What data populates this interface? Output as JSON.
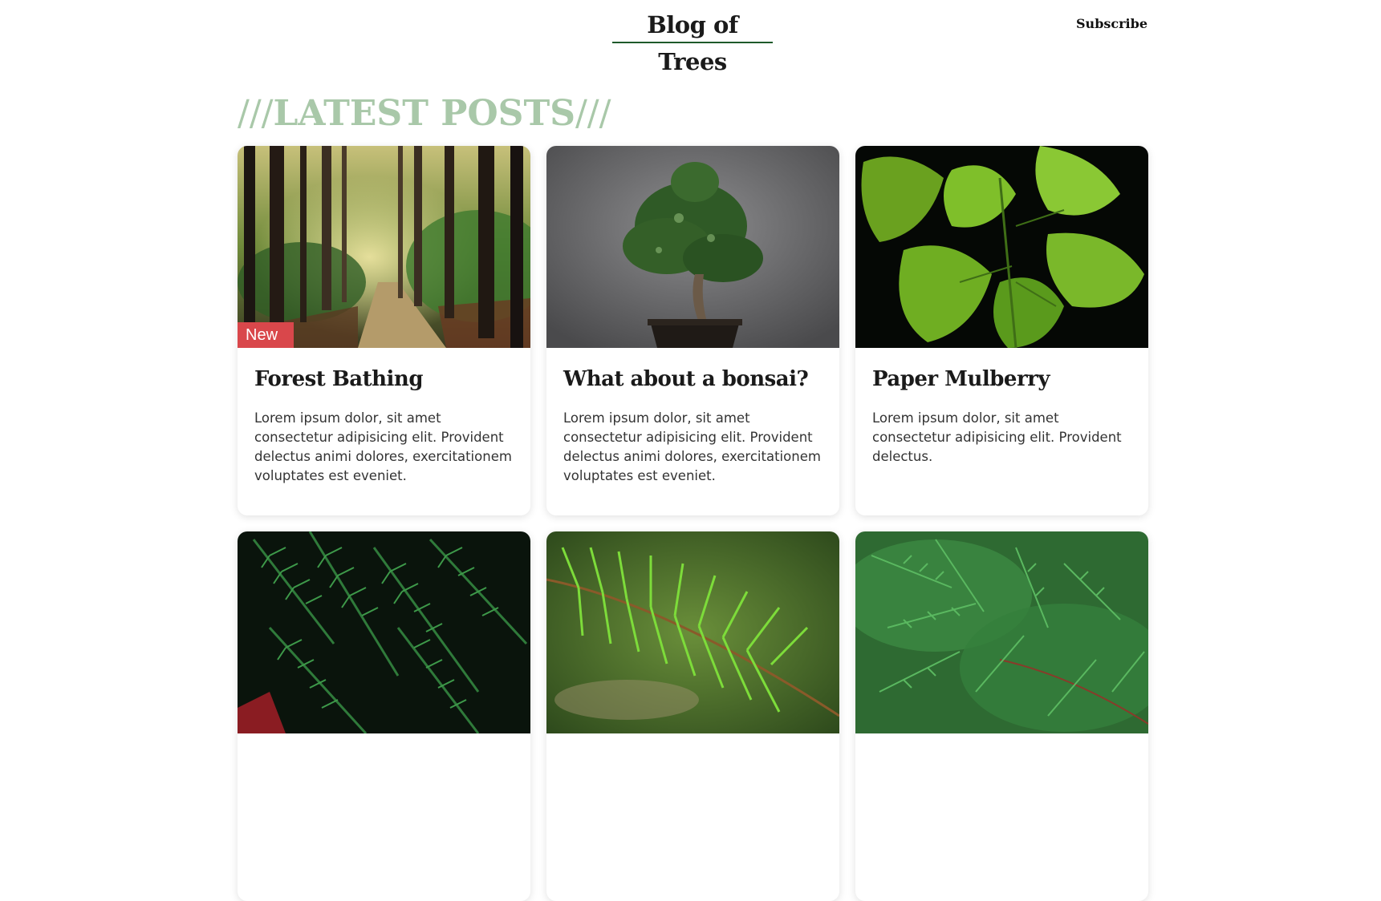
{
  "header": {
    "brand": "Blog of Trees",
    "subscribe": "Subscribe"
  },
  "section": {
    "slashes_left": "///",
    "title": "LATEST POSTS",
    "slashes_right": "///"
  },
  "colors": {
    "accent": "#1e5a2b",
    "section_title": "#a9c8a9",
    "badge": "#d9474b"
  },
  "posts": [
    {
      "image": "forest-path-image",
      "badge": "New",
      "title": "Forest Bathing",
      "text": "Lorem ipsum dolor, sit amet consectetur adipisicing elit. Provident delectus animi dolores, exercitationem voluptates est eveniet."
    },
    {
      "image": "bonsai-image",
      "badge": "",
      "title": "What about a bonsai?",
      "text": "Lorem ipsum dolor, sit amet consectetur adipisicing elit. Provident delectus animi dolores, exercitationem voluptates est eveniet."
    },
    {
      "image": "mulberry-leaves-image",
      "badge": "",
      "title": "Paper Mulberry",
      "text": "Lorem ipsum dolor, sit amet consectetur adipisicing elit. Provident delectus."
    },
    {
      "image": "redwood-branches-image",
      "badge": "",
      "title": "",
      "text": ""
    },
    {
      "image": "dawn-redwood-image",
      "badge": "",
      "title": "",
      "text": ""
    },
    {
      "image": "cypress-branches-image",
      "badge": "",
      "title": "",
      "text": ""
    }
  ]
}
